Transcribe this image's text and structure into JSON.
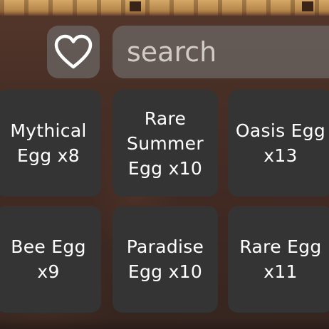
{
  "toolbar": {
    "favorites_icon": "heart-outline-icon",
    "search_placeholder": "search",
    "search_value": ""
  },
  "eggs": [
    {
      "label": "Mythical\nEgg x8"
    },
    {
      "label": "Rare\nSummer\nEgg x10"
    },
    {
      "label": "Oasis Egg\nx13"
    },
    {
      "label": "Bee Egg\nx9"
    },
    {
      "label": "Paradise\nEgg x10"
    },
    {
      "label": "Rare Egg\nx11"
    }
  ],
  "colors": {
    "tile_background": "#343434",
    "control_background": "#69645f",
    "text": "#ffffff"
  }
}
